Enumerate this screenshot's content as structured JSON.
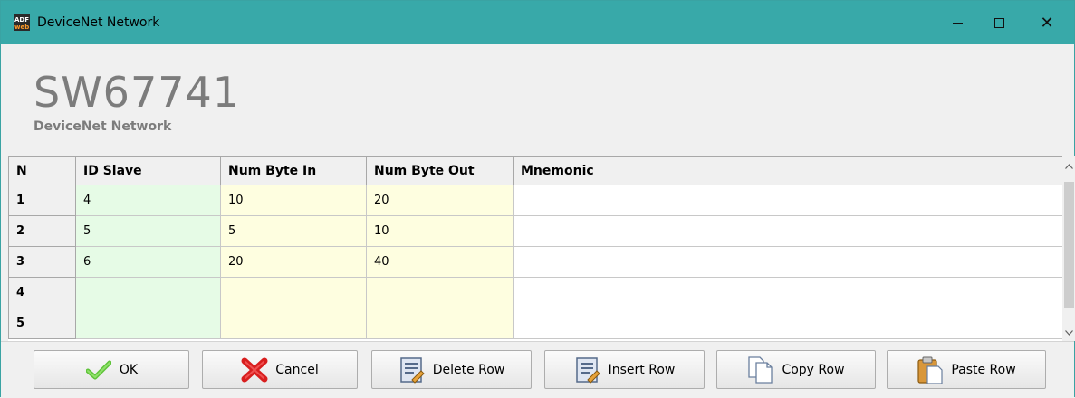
{
  "window": {
    "title": "DeviceNet Network",
    "icon": "adfweb-app-icon",
    "controls": [
      "minimize-icon",
      "maximize-icon",
      "close-icon"
    ],
    "close_glyph": "✕"
  },
  "header": {
    "title": "SW67741",
    "subtitle": "DeviceNet Network"
  },
  "grid": {
    "columns": [
      "N",
      "ID Slave",
      "Num Byte In",
      "Num Byte Out",
      "Mnemonic"
    ],
    "rows": [
      {
        "n": "1",
        "id_slave": "4",
        "num_byte_in": "10",
        "num_byte_out": "20",
        "mnemonic": ""
      },
      {
        "n": "2",
        "id_slave": "5",
        "num_byte_in": "5",
        "num_byte_out": "10",
        "mnemonic": ""
      },
      {
        "n": "3",
        "id_slave": "6",
        "num_byte_in": "20",
        "num_byte_out": "40",
        "mnemonic": ""
      },
      {
        "n": "4",
        "id_slave": "",
        "num_byte_in": "",
        "num_byte_out": "",
        "mnemonic": ""
      },
      {
        "n": "5",
        "id_slave": "",
        "num_byte_in": "",
        "num_byte_out": "",
        "mnemonic": ""
      }
    ],
    "colors": {
      "id_column": "#e6fbe6",
      "byte_columns": "#fefee0",
      "mnemonic": "#ffffff"
    }
  },
  "buttons": {
    "ok": {
      "label": "OK",
      "icon": "checkmark-icon"
    },
    "cancel": {
      "label": "Cancel",
      "icon": "cross-icon"
    },
    "delete_row": {
      "label": "Delete Row",
      "icon": "delete-row-icon"
    },
    "insert_row": {
      "label": "Insert Row",
      "icon": "insert-row-icon"
    },
    "copy_row": {
      "label": "Copy Row",
      "icon": "copy-icon"
    },
    "paste_row": {
      "label": "Paste Row",
      "icon": "paste-icon"
    }
  }
}
